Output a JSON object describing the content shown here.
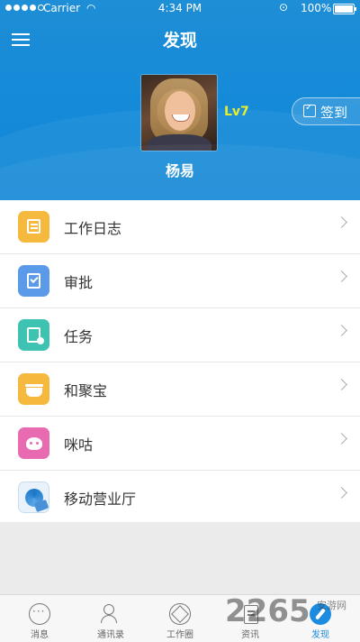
{
  "status_bar": {
    "carrier": "Carrier",
    "time": "4:34 PM",
    "battery": "100%",
    "signal_dots": 4,
    "signal_total": 5
  },
  "header": {
    "title": "发现",
    "menu_icon": "hamburger-menu-icon"
  },
  "profile": {
    "level": "Lv7",
    "checkin_label": "签到",
    "name": "杨易"
  },
  "menu_items": [
    {
      "label": "工作日志",
      "icon": "journal-icon",
      "color": "#f5b93d"
    },
    {
      "label": "审批",
      "icon": "approval-icon",
      "color": "#5b9ae8"
    },
    {
      "label": "任务",
      "icon": "task-icon",
      "color": "#3ec2b1"
    },
    {
      "label": "和聚宝",
      "icon": "treasure-icon",
      "color": "#f5b93d"
    },
    {
      "label": "咪咕",
      "icon": "migu-icon",
      "color": "#e86ab1"
    },
    {
      "label": "移动营业厅",
      "icon": "china-mobile-icon",
      "color": "#4a90d9"
    }
  ],
  "tabs": [
    {
      "label": "消息",
      "icon": "message-icon"
    },
    {
      "label": "通讯录",
      "icon": "contacts-icon"
    },
    {
      "label": "工作圈",
      "icon": "work-circle-icon"
    },
    {
      "label": "资讯",
      "icon": "news-icon"
    },
    {
      "label": "发现",
      "icon": "discover-icon",
      "active": true
    }
  ],
  "watermark": {
    "text": "2265",
    "subtext": "安游网"
  },
  "colors": {
    "header_blue": "#148ad8",
    "accent": "#1d8ce0",
    "level_yellow": "#e7ee2b"
  }
}
